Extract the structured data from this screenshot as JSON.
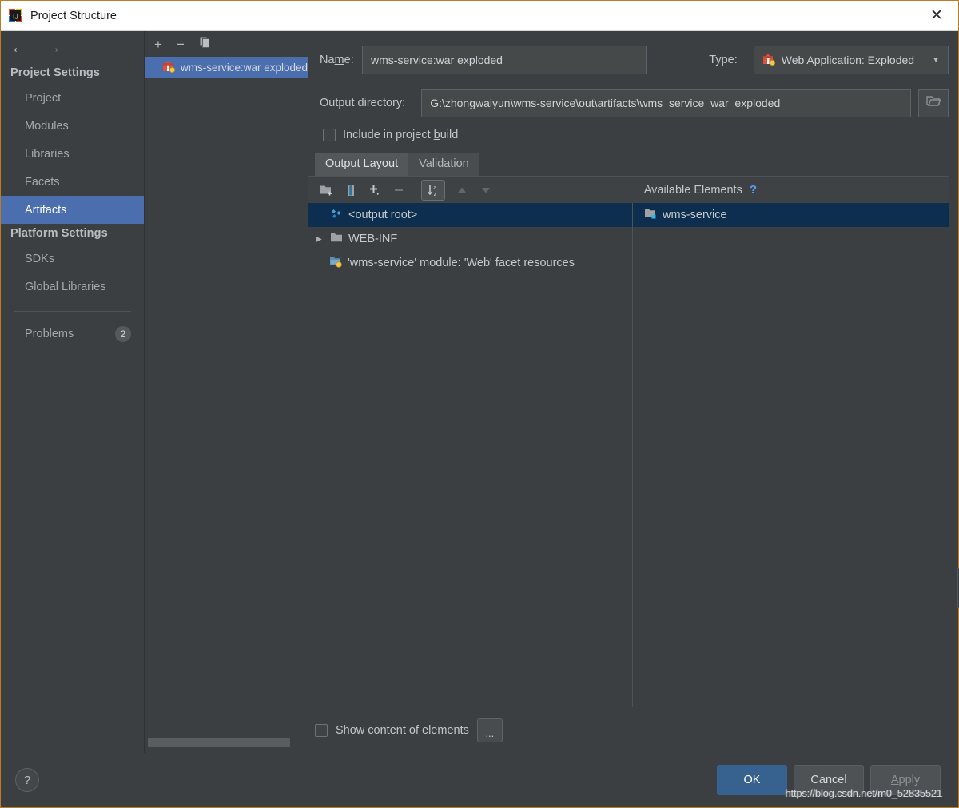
{
  "window": {
    "title": "Project Structure",
    "icon": "intellij-idea-icon",
    "close_label": "✕"
  },
  "nav": {
    "back": "←",
    "forward": "→"
  },
  "sidebar": {
    "groups": [
      {
        "title": "Project Settings",
        "items": [
          {
            "label": "Project",
            "selected": false
          },
          {
            "label": "Modules",
            "selected": false
          },
          {
            "label": "Libraries",
            "selected": false
          },
          {
            "label": "Facets",
            "selected": false
          },
          {
            "label": "Artifacts",
            "selected": true
          }
        ]
      },
      {
        "title": "Platform Settings",
        "items": [
          {
            "label": "SDKs",
            "selected": false
          },
          {
            "label": "Global Libraries",
            "selected": false
          }
        ]
      }
    ],
    "problems": {
      "label": "Problems",
      "count": "2"
    }
  },
  "artifacts_list": {
    "toolbar": {
      "add": "+",
      "remove": "−",
      "copy": "copy-icon"
    },
    "items": [
      {
        "label": "wms-service:war exploded",
        "icon": "artifact-war-icon",
        "selected": true
      }
    ]
  },
  "detail": {
    "name_label": "Name:",
    "name_mnemonic": "m",
    "name_value": "wms-service:war exploded",
    "type_label": "Type:",
    "type_value": "Web Application: Exploded",
    "type_icon": "artifact-war-icon",
    "output_dir_label": "Output directory:",
    "output_dir_value": "G:\\zhongwaiyun\\wms-service\\out\\artifacts\\wms_service_war_exploded",
    "browse_icon": "folder-open-icon",
    "include_in_build": {
      "label_before": "Include in project ",
      "mnemonic": "b",
      "label_after": "uild",
      "checked": false
    },
    "tabs": [
      {
        "label": "Output Layout",
        "active": true
      },
      {
        "label": "Validation",
        "active": false
      }
    ],
    "layout_toolbar": {
      "new_directory": "new-folder-icon",
      "new_archive": "new-archive-icon",
      "add": "plus-dropdown-icon",
      "remove": "minus-icon",
      "sort": "sort-alphabetical-icon",
      "move_up": "arrow-up-icon",
      "move_down": "arrow-down-icon"
    },
    "available_elements_label": "Available Elements",
    "help_glyph": "?",
    "output_tree": [
      {
        "label": "<output root>",
        "icon": "output-root-icon",
        "selected": true,
        "expandable": false,
        "depth": 0
      },
      {
        "label": "WEB-INF",
        "icon": "folder-icon",
        "selected": false,
        "expandable": true,
        "expanded": false,
        "depth": 0
      },
      {
        "label": "'wms-service' module: 'Web' facet resources",
        "icon": "web-facet-resources-icon",
        "selected": false,
        "expandable": false,
        "depth": 1
      }
    ],
    "available_tree": [
      {
        "label": "wms-service",
        "icon": "module-icon",
        "selected": true
      }
    ],
    "show_content": {
      "label": "Show content of elements",
      "checked": false
    },
    "dots_button": "..."
  },
  "footer": {
    "help": "?",
    "ok": "OK",
    "cancel": "Cancel",
    "apply_before": "",
    "apply_mnemonic": "A",
    "apply_after": "pply",
    "apply": "Apply",
    "watermark": "https://blog.csdn.net/m0_52835521"
  },
  "colors": {
    "accent_selection": "#4b6eaf",
    "primary_button": "#37618e",
    "panel_bg": "#3c3f41",
    "tree_selection": "#0d2e4e",
    "window_border": "#c07a26",
    "link": "#589df6"
  }
}
